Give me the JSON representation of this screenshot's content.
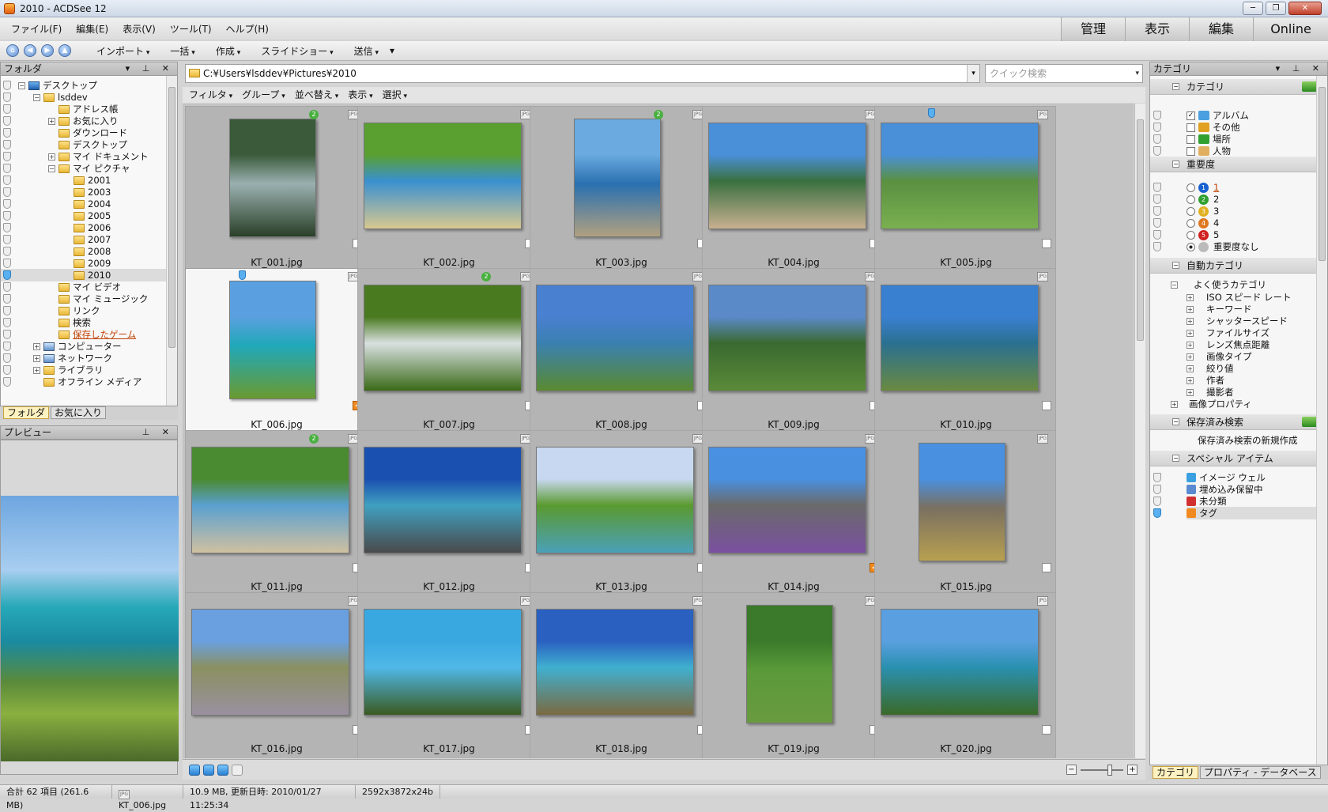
{
  "window": {
    "title": "2010 - ACDSee 12"
  },
  "menu": [
    "ファイル(F)",
    "編集(E)",
    "表示(V)",
    "ツール(T)",
    "ヘルプ(H)"
  ],
  "modes": [
    "管理",
    "表示",
    "編集",
    "Online"
  ],
  "toolbar": {
    "items": [
      "インポート",
      "一括",
      "作成",
      "スライドショー",
      "送信"
    ]
  },
  "folder_panel": {
    "title": "フォルダ",
    "tree": [
      {
        "label": "デスクトップ",
        "depth": 0,
        "icon": "desktop"
      },
      {
        "label": "lsddev",
        "depth": 1,
        "icon": "user-folder"
      },
      {
        "label": "アドレス帳",
        "depth": 2,
        "icon": "folder"
      },
      {
        "label": "お気に入り",
        "depth": 2,
        "icon": "folder"
      },
      {
        "label": "ダウンロード",
        "depth": 2,
        "icon": "folder"
      },
      {
        "label": "デスクトップ",
        "depth": 2,
        "icon": "folder"
      },
      {
        "label": "マイ ドキュメント",
        "depth": 2,
        "icon": "folder"
      },
      {
        "label": "マイ ピクチャ",
        "depth": 2,
        "icon": "folder"
      },
      {
        "label": "2001",
        "depth": 3,
        "icon": "folder"
      },
      {
        "label": "2003",
        "depth": 3,
        "icon": "folder"
      },
      {
        "label": "2004",
        "depth": 3,
        "icon": "folder"
      },
      {
        "label": "2005",
        "depth": 3,
        "icon": "folder"
      },
      {
        "label": "2006",
        "depth": 3,
        "icon": "folder"
      },
      {
        "label": "2007",
        "depth": 3,
        "icon": "folder"
      },
      {
        "label": "2008",
        "depth": 3,
        "icon": "folder"
      },
      {
        "label": "2009",
        "depth": 3,
        "icon": "folder"
      },
      {
        "label": "2010",
        "depth": 3,
        "icon": "folder",
        "selected": true
      },
      {
        "label": "マイ ビデオ",
        "depth": 2,
        "icon": "folder"
      },
      {
        "label": "マイ ミュージック",
        "depth": 2,
        "icon": "folder"
      },
      {
        "label": "リンク",
        "depth": 2,
        "icon": "folder"
      },
      {
        "label": "検索",
        "depth": 2,
        "icon": "folder"
      },
      {
        "label": "保存したゲーム",
        "depth": 2,
        "icon": "folder",
        "link": true
      },
      {
        "label": "コンピューター",
        "depth": 1,
        "icon": "computer"
      },
      {
        "label": "ネットワーク",
        "depth": 1,
        "icon": "network"
      },
      {
        "label": "ライブラリ",
        "depth": 1,
        "icon": "folder"
      },
      {
        "label": "オフライン メディア",
        "depth": 1,
        "icon": "folder"
      }
    ],
    "tabs": [
      "フォルダ",
      "お気に入り"
    ]
  },
  "preview_panel": {
    "title": "プレビュー"
  },
  "path": "C:¥Users¥lsddev¥Pictures¥2010",
  "quick_search_placeholder": "クイック検索",
  "filter_bar": [
    "フィルタ",
    "グループ",
    "並べ替え",
    "表示",
    "選択"
  ],
  "files": [
    {
      "name": "KT_001.jpg",
      "rating": "2",
      "tagged": false,
      "orient": "portrait",
      "colors": [
        "#3a5a3a",
        "#9ab0b0",
        "#2a4028"
      ]
    },
    {
      "name": "KT_002.jpg",
      "rating": "",
      "tagged": false,
      "orient": "landscape",
      "colors": [
        "#5aa030",
        "#3a90d0",
        "#d8c890"
      ]
    },
    {
      "name": "KT_003.jpg",
      "rating": "2",
      "tagged": false,
      "orient": "portrait",
      "colors": [
        "#6aaae0",
        "#2a70b0",
        "#b0a080"
      ]
    },
    {
      "name": "KT_004.jpg",
      "rating": "",
      "tagged": false,
      "orient": "landscape",
      "colors": [
        "#4a90d8",
        "#3a7040",
        "#c8b090"
      ]
    },
    {
      "name": "KT_005.jpg",
      "rating": "",
      "tagged": false,
      "pinned": true,
      "orient": "landscape",
      "colors": [
        "#4a90d8",
        "#5a9040",
        "#7ab050"
      ]
    },
    {
      "name": "KT_006.jpg",
      "rating": "",
      "tagged": true,
      "pinned": true,
      "selected": true,
      "orient": "portrait",
      "colors": [
        "#5aa0e0",
        "#20a8b8",
        "#6a9a30"
      ]
    },
    {
      "name": "KT_007.jpg",
      "rating": "2",
      "tagged": false,
      "orient": "landscape",
      "colors": [
        "#4a7a20",
        "#d8e0e0",
        "#3a6a18"
      ]
    },
    {
      "name": "KT_008.jpg",
      "rating": "",
      "tagged": false,
      "orient": "landscape",
      "colors": [
        "#4a80d0",
        "#3a80b0",
        "#5a8a30"
      ]
    },
    {
      "name": "KT_009.jpg",
      "rating": "",
      "tagged": false,
      "orient": "landscape",
      "colors": [
        "#5a8ac8",
        "#3a6a30",
        "#5a8a38"
      ]
    },
    {
      "name": "KT_010.jpg",
      "rating": "",
      "tagged": false,
      "orient": "landscape",
      "colors": [
        "#3a80d0",
        "#2a7090",
        "#6a8a40"
      ]
    },
    {
      "name": "KT_011.jpg",
      "rating": "2",
      "tagged": false,
      "orient": "landscape",
      "colors": [
        "#4a8a30",
        "#5aa0d0",
        "#d0c0a0"
      ]
    },
    {
      "name": "KT_012.jpg",
      "rating": "",
      "tagged": false,
      "orient": "landscape",
      "colors": [
        "#1a50b0",
        "#40a0c0",
        "#4a4a4a"
      ]
    },
    {
      "name": "KT_013.jpg",
      "rating": "",
      "tagged": false,
      "orient": "landscape",
      "colors": [
        "#c8d8f0",
        "#5a9a30",
        "#4aa0b8"
      ]
    },
    {
      "name": "KT_014.jpg",
      "rating": "",
      "tagged": true,
      "orient": "landscape",
      "colors": [
        "#4a90e0",
        "#6a6a6a",
        "#7a50a0"
      ]
    },
    {
      "name": "KT_015.jpg",
      "rating": "",
      "tagged": false,
      "orient": "portrait",
      "colors": [
        "#4a90e0",
        "#7a7060",
        "#b8a050"
      ]
    },
    {
      "name": "KT_016.jpg",
      "rating": "",
      "tagged": false,
      "orient": "landscape",
      "colors": [
        "#6aa0e0",
        "#8a9060",
        "#9a90a0"
      ]
    },
    {
      "name": "KT_017.jpg",
      "rating": "",
      "tagged": false,
      "orient": "landscape",
      "colors": [
        "#3aa8e0",
        "#50b8e8",
        "#3a5a20"
      ]
    },
    {
      "name": "KT_018.jpg",
      "rating": "",
      "tagged": false,
      "orient": "landscape",
      "colors": [
        "#2a60c0",
        "#40b0d0",
        "#7a6a40"
      ]
    },
    {
      "name": "KT_019.jpg",
      "rating": "",
      "tagged": false,
      "orient": "portrait",
      "colors": [
        "#3a7a2a",
        "#5a9a3a",
        "#6a9a40"
      ]
    },
    {
      "name": "KT_020.jpg",
      "rating": "",
      "tagged": false,
      "orient": "landscape",
      "colors": [
        "#5aa0e0",
        "#2a90b0",
        "#3a6a28"
      ]
    }
  ],
  "category_panel": {
    "title": "カテゴリ",
    "sections": {
      "categories": {
        "title": "カテゴリ",
        "items": [
          "アルバム",
          "その他",
          "場所",
          "人物"
        ]
      },
      "rating": {
        "title": "重要度",
        "items": [
          "1",
          "2",
          "3",
          "4",
          "5",
          "重要度なし"
        ],
        "colors": [
          "#1a60d0",
          "#30a030",
          "#e0b020",
          "#e07820",
          "#d02020",
          "#bbbbbb"
        ]
      },
      "auto": {
        "title": "自動カテゴリ",
        "root": "よく使うカテゴリ",
        "items": [
          "ISO スピード レート",
          "キーワード",
          "シャッタースピード",
          "ファイルサイズ",
          "レンズ焦点距離",
          "画像タイプ",
          "絞り値",
          "作者",
          "撮影者"
        ],
        "props": "画像プロパティ"
      },
      "saved": {
        "title": "保存済み検索",
        "new": "保存済み検索の新規作成"
      },
      "special": {
        "title": "スペシャル アイテム",
        "items": [
          "イメージ ウェル",
          "埋め込み保留中",
          "未分類",
          "タグ"
        ]
      }
    },
    "tabs": [
      "カテゴリ",
      "プロパティ - データベース"
    ]
  },
  "status": {
    "total": "合計 62 項目 (261.6 MB)",
    "file": "KT_006.jpg",
    "info": "10.9 MB, 更新日時: 2010/01/27 11:25:34",
    "dims": "2592x3872x24b"
  }
}
